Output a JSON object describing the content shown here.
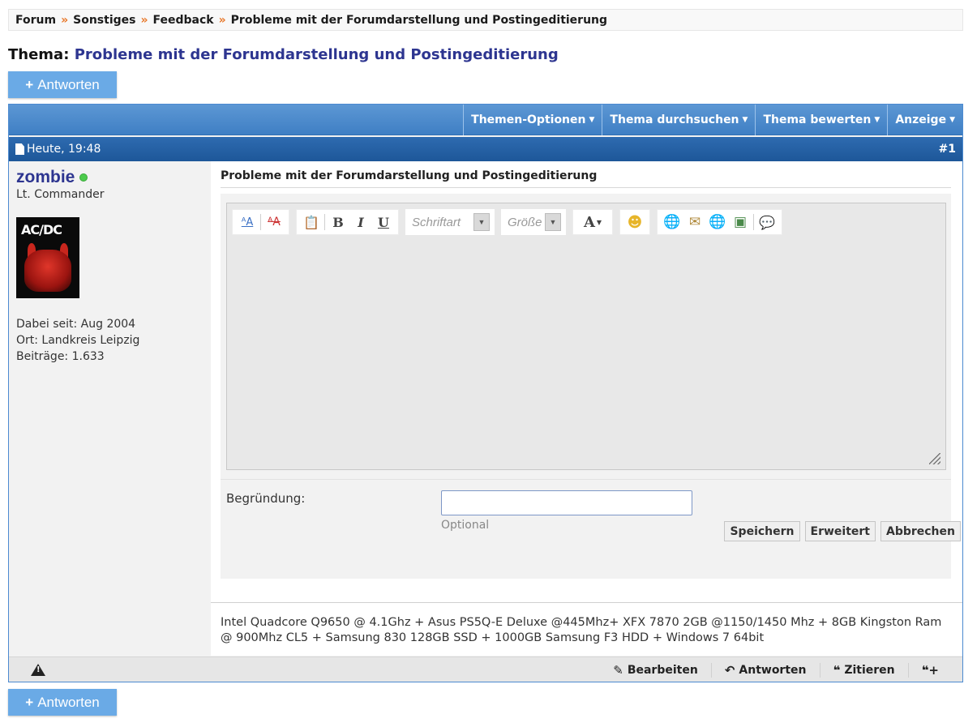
{
  "breadcrumb": {
    "items": [
      "Forum",
      "Sonstiges",
      "Feedback",
      "Probleme mit der Forumdarstellung und Postingeditierung"
    ],
    "separator": "»"
  },
  "thread": {
    "label": "Thema:",
    "title": "Probleme mit der Forumdarstellung und Postingeditierung"
  },
  "reply_button": {
    "plus": "+",
    "label": "Antworten"
  },
  "thread_toolbar": {
    "items": [
      "Themen-Optionen",
      "Thema durchsuchen",
      "Thema bewerten",
      "Anzeige"
    ]
  },
  "post": {
    "date": "Heute, 19:48",
    "number": "#1",
    "title": "Probleme mit der Forumdarstellung und Postingeditierung",
    "user": {
      "name": "zombie",
      "rank": "Lt. Commander",
      "avatar_text": "AC/DC",
      "joined": "Dabei seit: Aug 2004",
      "location": "Ort: Landkreis Leipzig",
      "posts": "Beiträge: 1.633"
    },
    "signature": "Intel Quadcore Q9650 @ 4.1Ghz + Asus PS5Q-E Deluxe @445Mhz+ XFX 7870 2GB @1150/1450 Mhz + 8GB Kingston Ram @ 900Mhz CL5 + Samsung 830 128GB SSD + 1000GB Samsung F3 HDD + Windows 7 64bit"
  },
  "editor": {
    "font_placeholder": "Schriftart",
    "size_placeholder": "Größe",
    "text_color_label": "A",
    "bold": "B",
    "italic": "I",
    "underline": "U",
    "reason_label": "Begründung:",
    "reason_hint": "Optional",
    "reason_value": "",
    "save": "Speichern",
    "advanced": "Erweitert",
    "cancel": "Abbrechen"
  },
  "footer": {
    "edit": "Bearbeiten",
    "reply": "Antworten",
    "quote": "Zitieren"
  },
  "colors": {
    "accent": "#2d3590",
    "toolbar_blue": "#4c8ad0",
    "header_blue": "#1d5799",
    "button_blue": "#6aaae6",
    "breadcrumb_sep": "#e8782a",
    "online": "#4ccb4c"
  }
}
